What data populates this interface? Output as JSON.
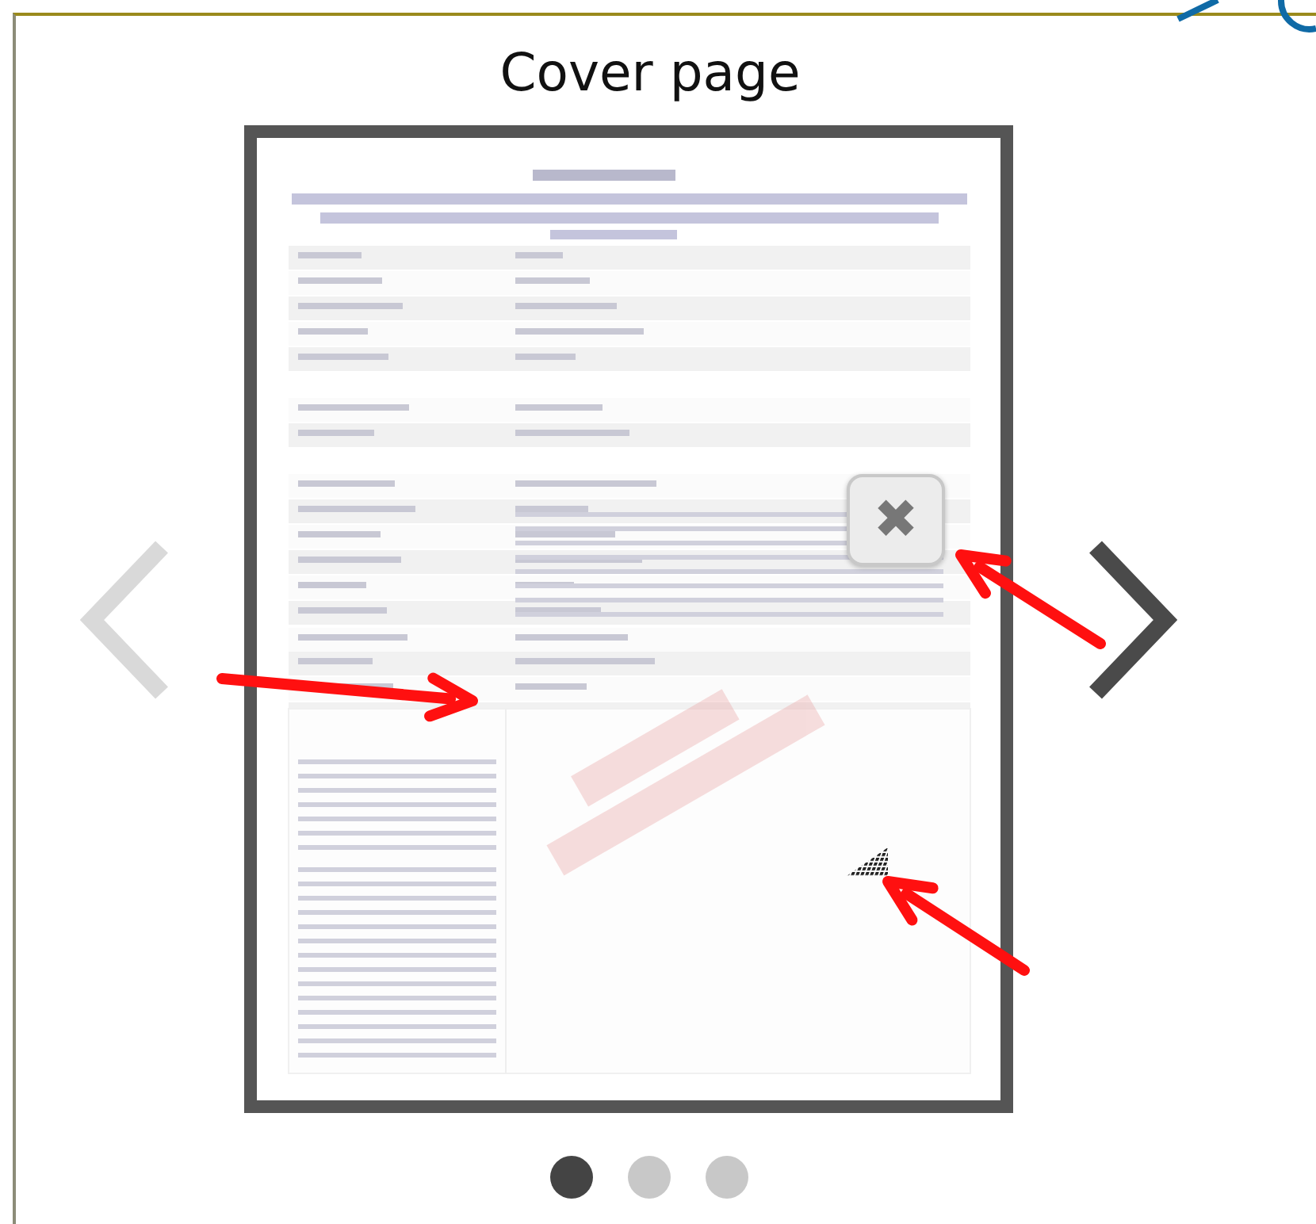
{
  "title": "Cover page",
  "prev_button": {
    "disabled": true
  },
  "next_button": {
    "disabled": false
  },
  "close_button": {
    "label": "✖"
  },
  "pages": [
    {
      "selected": true
    },
    {
      "selected": false
    },
    {
      "selected": false
    }
  ]
}
